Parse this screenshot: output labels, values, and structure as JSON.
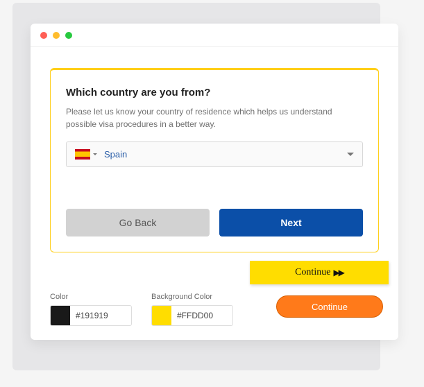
{
  "form": {
    "question": "Which country are you from?",
    "helper": "Please let us know your country of residence which helps us understand possible visa procedures in a better way.",
    "selected_country": "Spain",
    "back_label": "Go Back",
    "next_label": "Next"
  },
  "continue_yellow_label": "Continue",
  "continue_orange_label": "Continue",
  "color_picker": {
    "text_label": "Color",
    "text_value": "#191919",
    "bg_label": "Background Color",
    "bg_value": "#FFDD00"
  }
}
